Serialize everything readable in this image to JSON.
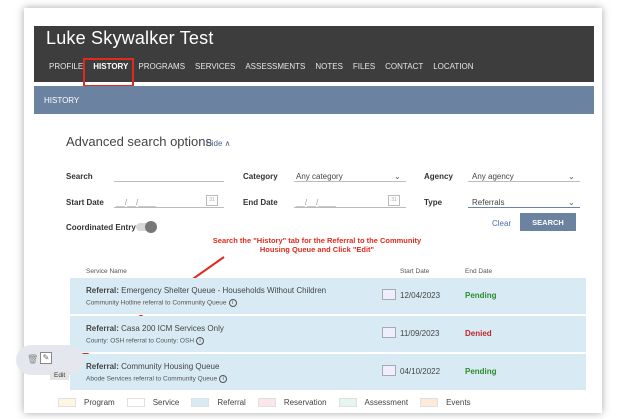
{
  "client": {
    "name": "Luke Skywalker Test"
  },
  "tabs": [
    {
      "label": "PROFILE"
    },
    {
      "label": "HISTORY"
    },
    {
      "label": "PROGRAMS"
    },
    {
      "label": "SERVICES"
    },
    {
      "label": "ASSESSMENTS"
    },
    {
      "label": "NOTES"
    },
    {
      "label": "FILES"
    },
    {
      "label": "CONTACT"
    },
    {
      "label": "LOCATION"
    }
  ],
  "active_tab": "HISTORY",
  "section": {
    "title": "HISTORY"
  },
  "search": {
    "title": "Advanced search options",
    "hide_label": "Hide ∧",
    "search_label": "Search",
    "search_value": "",
    "category_label": "Category",
    "category_value": "Any category",
    "agency_label": "Agency",
    "agency_value": "Any agency",
    "start_date_label": "Start Date",
    "start_date_placeholder": "__/__/____",
    "end_date_label": "End Date",
    "end_date_placeholder": "__/__/____",
    "type_label": "Type",
    "type_value": "Referrals",
    "coordinated_entry_label": "Coordinated Entry",
    "clear_label": "Clear",
    "search_button": "SEARCH"
  },
  "annotation": "Search the \"History\" tab for the Referral to the Community Housing Queue and Click \"Edit\"",
  "table": {
    "headers": {
      "service_name": "Service Name",
      "start_date": "Start Date",
      "end_date": "End Date"
    },
    "rows": [
      {
        "prefix": "Referral:",
        "title": "Emergency Shelter Queue - Households Without Children",
        "subtitle": "Community Hotline referral to Community Queue",
        "start_date": "12/04/2023",
        "status": "Pending",
        "status_color": "#2e8b2e"
      },
      {
        "prefix": "Referral:",
        "title": "Casa 200 ICM Services Only",
        "subtitle": "County: OSH referral to County: OSH",
        "start_date": "11/09/2023",
        "status": "Denied",
        "status_color": "#c0262d"
      },
      {
        "prefix": "Referral:",
        "title": "Community Housing Queue",
        "subtitle": "Abode Services referral to Community Queue",
        "start_date": "04/10/2022",
        "status": "Pending",
        "status_color": "#2e8b2e"
      }
    ]
  },
  "edit_tooltip": "Edit",
  "legend": [
    {
      "label": "Program",
      "color": "#fdf6e3"
    },
    {
      "label": "Service",
      "color": "#ffffff"
    },
    {
      "label": "Referral",
      "color": "#d8ebf5"
    },
    {
      "label": "Reservation",
      "color": "#fbe6ea"
    },
    {
      "label": "Assessment",
      "color": "#e6f5ef"
    },
    {
      "label": "Events",
      "color": "#fdeadb"
    }
  ],
  "colors": {
    "accent": "#6b82a1",
    "header_bg": "#3d3d3d",
    "annotation": "#e02a1f"
  }
}
